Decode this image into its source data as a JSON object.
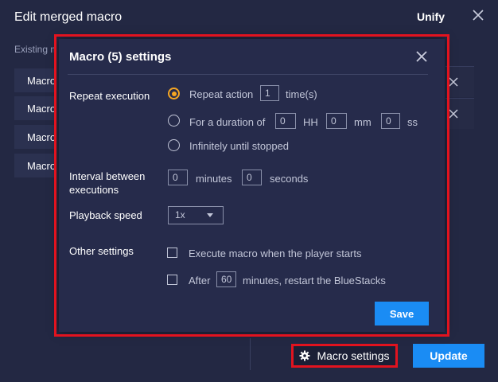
{
  "background_dialog": {
    "title": "Edit merged macro",
    "unify_label": "Unify",
    "existing_label": "Existing macros",
    "items": [
      "Macro",
      "Macro",
      "Macro",
      "Macro"
    ],
    "macro_settings_label": "Macro settings",
    "update_label": "Update"
  },
  "modal": {
    "title": "Macro (5) settings",
    "repeat_execution": {
      "label": "Repeat execution",
      "selected": "repeat_action",
      "repeat_action": {
        "label": "Repeat action",
        "value": "1",
        "unit": "time(s)"
      },
      "duration": {
        "label": "For a duration of",
        "hours": "0",
        "hours_unit": "HH",
        "minutes": "0",
        "minutes_unit": "mm",
        "seconds": "0",
        "seconds_unit": "ss"
      },
      "infinite": {
        "label": "Infinitely until stopped"
      }
    },
    "interval": {
      "label": "Interval between executions",
      "minutes": "0",
      "minutes_unit": "minutes",
      "seconds": "0",
      "seconds_unit": "seconds"
    },
    "playback_speed": {
      "label": "Playback speed",
      "value": "1x"
    },
    "other_settings": {
      "label": "Other settings",
      "execute_on_start": {
        "label": "Execute macro when the player starts",
        "checked": false
      },
      "restart": {
        "prefix": "After",
        "value": "60",
        "suffix": "minutes, restart the BlueStacks",
        "checked": false
      }
    },
    "save_label": "Save"
  },
  "colors": {
    "background": "#232843",
    "modal": "#262b4b",
    "accent_blue": "#1a8cf4",
    "radio_selected": "#f5a623",
    "highlight_red": "#e2131f"
  },
  "icons": [
    "close-icon",
    "gear-icon",
    "caret-down-icon"
  ]
}
